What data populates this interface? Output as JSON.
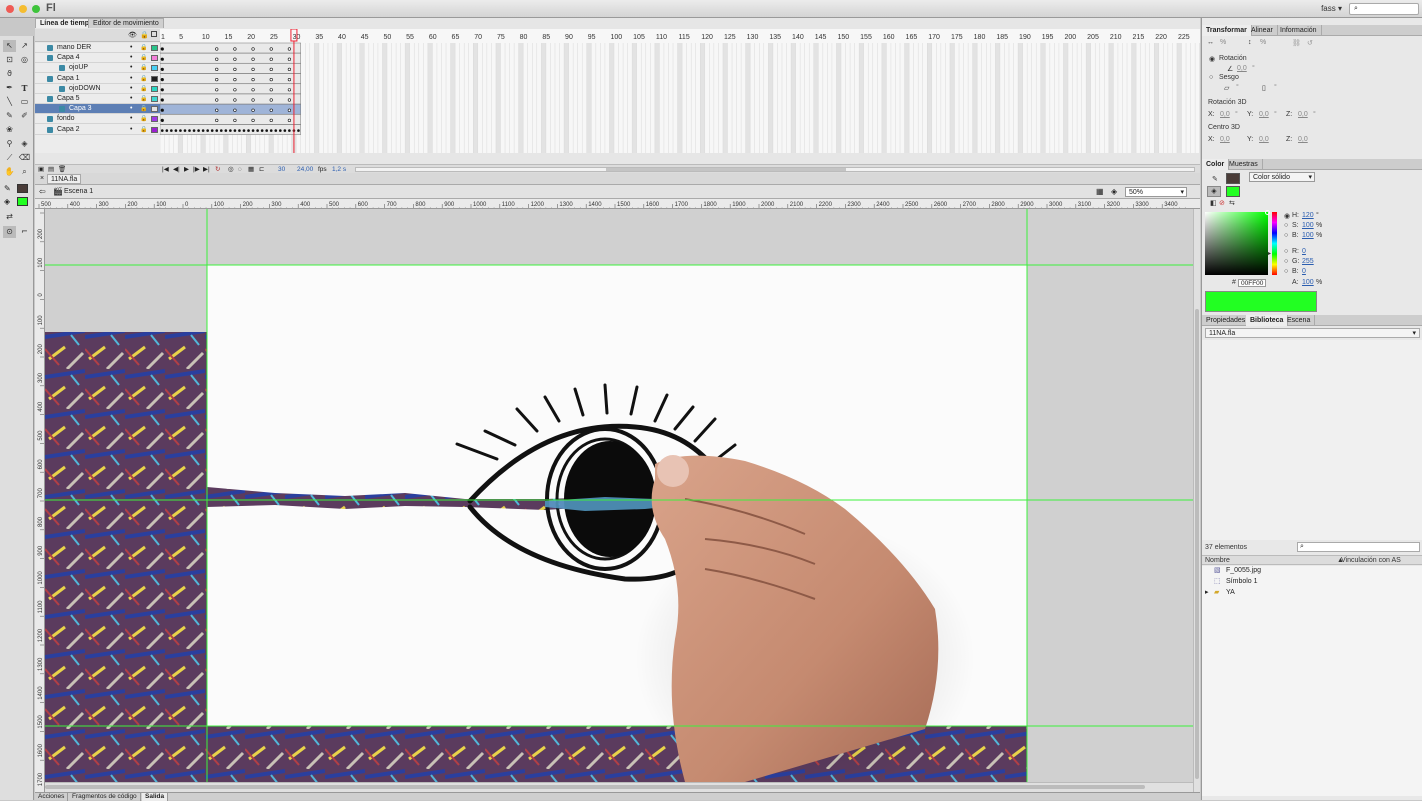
{
  "app": {
    "logo": "Fl",
    "user": "fass",
    "user_caret": "▾"
  },
  "timeline": {
    "tabs": [
      "Línea de tiempo",
      "Editor de movimiento"
    ],
    "frame_numbers": [
      "1",
      "5",
      "10",
      "15",
      "20",
      "25",
      "30",
      "35",
      "40",
      "45",
      "50",
      "55",
      "60",
      "65",
      "70",
      "75",
      "80",
      "85",
      "90",
      "95",
      "100",
      "105",
      "110",
      "115",
      "120",
      "125",
      "130",
      "135",
      "140",
      "145",
      "150",
      "155",
      "160",
      "165",
      "170",
      "175",
      "180",
      "185",
      "190",
      "195",
      "200",
      "205",
      "210",
      "215",
      "220",
      "225"
    ],
    "layers": [
      {
        "name": "mano DER",
        "color": "#29c48a",
        "sel": false
      },
      {
        "name": "Capa 4",
        "color": "#f37fd9",
        "sel": false
      },
      {
        "name": "ojoUP",
        "color": "#4ad0f2",
        "sel": false
      },
      {
        "name": "Capa 1",
        "color": "#1e1e1e",
        "sel": false
      },
      {
        "name": "ojoDOWN",
        "color": "#2bd6c2",
        "sel": false
      },
      {
        "name": "Capa 5",
        "color": "#40d8d0",
        "sel": false
      },
      {
        "name": "Capa 3",
        "color": "#e3e3e3",
        "sel": true
      },
      {
        "name": "fondo",
        "color": "#a039e6",
        "sel": false
      },
      {
        "name": "Capa 2",
        "color": "#9b1fd0",
        "sel": false
      }
    ],
    "current_frame": "30",
    "fps": "24,00",
    "fps_unit": "fps",
    "time": "1,2 s"
  },
  "document": {
    "tab": "11NA.fla",
    "scene": "Escena 1",
    "zoom": "50%"
  },
  "rulers": {
    "h": [
      "500",
      "400",
      "300",
      "200",
      "100",
      "0",
      "100",
      "200",
      "300",
      "400",
      "500",
      "600",
      "700",
      "800",
      "900",
      "1000",
      "1100",
      "1200",
      "1300",
      "1400",
      "1500",
      "1600",
      "1700",
      "1800",
      "1900",
      "2000",
      "2100",
      "2200",
      "2300",
      "2400",
      "2500",
      "2600",
      "2700",
      "2800",
      "2900",
      "3000",
      "3100",
      "3200",
      "3300",
      "3400"
    ],
    "v": [
      "200",
      "100",
      "0",
      "100",
      "200",
      "300",
      "400",
      "500",
      "600",
      "700",
      "800",
      "900",
      "1000",
      "1100",
      "1200",
      "1300",
      "1400",
      "1500",
      "1600",
      "1700"
    ]
  },
  "bottom_tabs": [
    "Acciones",
    "Fragmentos de código",
    "Salida"
  ],
  "transform": {
    "tabs": [
      "Transformar",
      "Alinear",
      "Información"
    ],
    "width_pct": "%",
    "height_pct": "%",
    "rot_label": "Rotación",
    "rot_val": "0,0",
    "rot_unit": "°",
    "skew_label": "Sesgo",
    "skew_h": "°",
    "skew_v": "°",
    "r3d_label": "Rotación 3D",
    "x_label": "X:",
    "y_label": "Y:",
    "z_label": "Z:",
    "r3d_x": "0,0",
    "r3d_y": "0,0",
    "r3d_z": "0,0",
    "deg": "°",
    "center3d_label": "Centro 3D",
    "c_x": "0,0",
    "c_y": "0,0",
    "c_z": "0,0"
  },
  "color": {
    "tabs": [
      "Color",
      "Muestras"
    ],
    "type": "Color sólido",
    "h_label": "H:",
    "h": "120",
    "h_unit": "°",
    "s_label": "S:",
    "s": "100",
    "s_unit": "%",
    "b_label": "B:",
    "b": "100",
    "b_unit": "%",
    "r_label": "R:",
    "r": "0",
    "g_label": "G:",
    "g": "255",
    "bl_label": "B:",
    "bl": "0",
    "a_label": "A:",
    "a": "100",
    "a_unit": "%",
    "hash": "#",
    "hex": "00FF00",
    "swatch": "#22ff22",
    "stroke": "#4a3c38"
  },
  "library": {
    "tabs": [
      "Propiedades",
      "Biblioteca",
      "Escena"
    ],
    "doc": "11NA.fla",
    "count": "37 elementos",
    "col_name": "Nombre",
    "col_link": "Vinculación con AS",
    "items": [
      {
        "name": "F_0055.jpg",
        "icon": "bitmap-icon"
      },
      {
        "name": "Símbolo 1",
        "icon": "movieclip-icon"
      },
      {
        "name": "YA",
        "icon": "folder-icon"
      }
    ]
  }
}
